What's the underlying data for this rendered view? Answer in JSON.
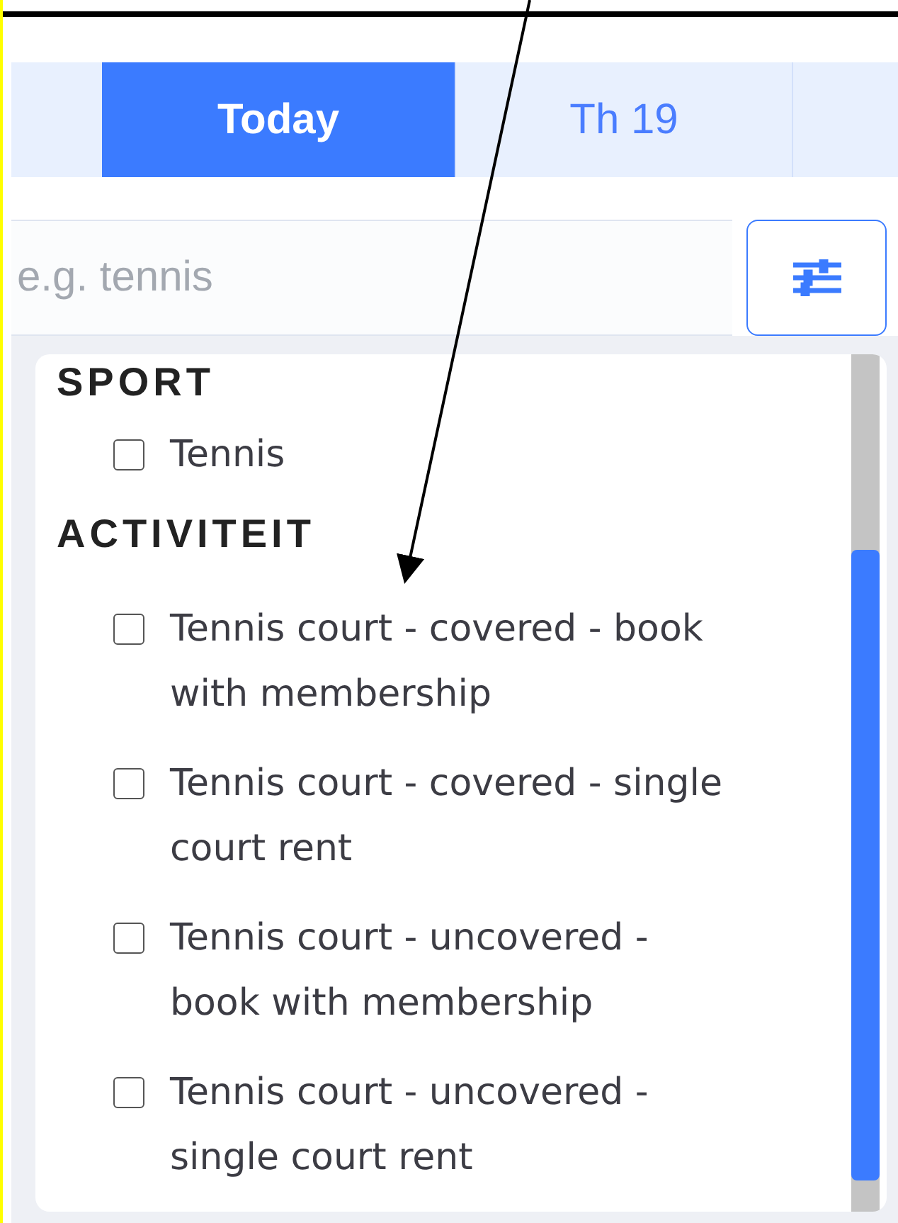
{
  "tabs": [
    {
      "label": "Today",
      "selected": true
    },
    {
      "label": "Th 19",
      "selected": false
    }
  ],
  "search": {
    "placeholder": "e.g. tennis"
  },
  "filter_panel": {
    "groups": [
      {
        "title": "SPORT",
        "options": [
          {
            "label": "Tennis",
            "checked": false
          }
        ]
      },
      {
        "title": "ACTIVITEIT",
        "options": [
          {
            "label": "Tennis court - covered - book with membership",
            "checked": false
          },
          {
            "label": "Tennis court - covered - single court rent",
            "checked": false
          },
          {
            "label": "Tennis court - uncovered - book with membership",
            "checked": false
          },
          {
            "label": "Tennis court - uncovered - single court rent",
            "checked": false
          }
        ]
      }
    ]
  }
}
